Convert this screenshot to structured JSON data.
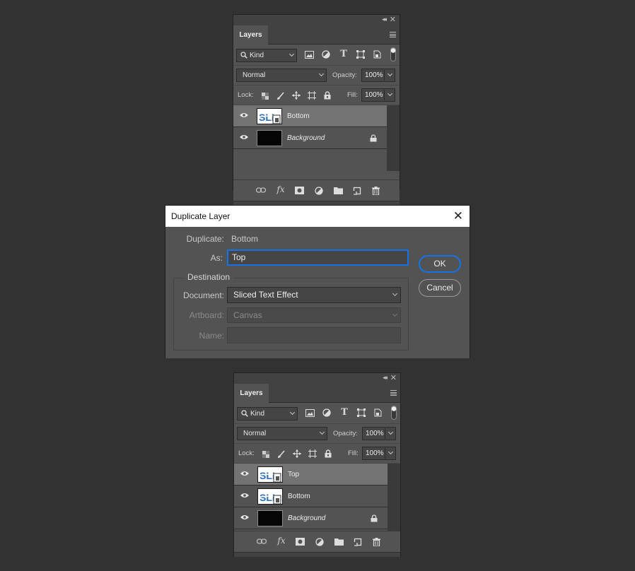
{
  "panel_top": {
    "tab": "Layers",
    "filter_kind": "Kind",
    "blend_mode": "Normal",
    "opacity_label": "Opacity:",
    "opacity": "100%",
    "lock_label": "Lock:",
    "fill_label": "Fill:",
    "fill": "100%",
    "layers": [
      {
        "name": "Bottom",
        "selected": true,
        "thumb": "text-effect",
        "locked": false,
        "italic": false
      },
      {
        "name": "Background",
        "selected": false,
        "thumb": "black",
        "locked": true,
        "italic": true
      }
    ]
  },
  "dialog": {
    "title": "Duplicate Layer",
    "duplicate_label": "Duplicate:",
    "duplicate_value": "Bottom",
    "as_label": "As:",
    "as_value": "Top",
    "destination_legend": "Destination",
    "document_label": "Document:",
    "document_value": "Sliced Text Effect",
    "artboard_label": "Artboard:",
    "artboard_value": "Canvas",
    "name_label": "Name:",
    "name_value": "",
    "ok_label": "OK",
    "cancel_label": "Cancel",
    "close_glyph": "✕"
  },
  "panel_bottom": {
    "tab": "Layers",
    "filter_kind": "Kind",
    "blend_mode": "Normal",
    "opacity_label": "Opacity:",
    "opacity": "100%",
    "lock_label": "Lock:",
    "fill_label": "Fill:",
    "fill": "100%",
    "layers": [
      {
        "name": "Top",
        "selected": true,
        "thumb": "text-effect",
        "locked": false,
        "italic": false
      },
      {
        "name": "Bottom",
        "selected": false,
        "thumb": "text-effect",
        "locked": false,
        "italic": false
      },
      {
        "name": "Background",
        "selected": false,
        "thumb": "black",
        "locked": true,
        "italic": true
      }
    ]
  },
  "colors": {
    "app_bg": "#323232",
    "panel_bg": "#535353",
    "selected_layer": "#737373",
    "accent_focus": "#1473e6"
  },
  "icons": {
    "filter": [
      "search-icon",
      "image-filter-icon",
      "adjustment-filter-icon",
      "type-filter-icon",
      "shape-filter-icon",
      "smart-object-filter-icon",
      "filter-toggle-icon"
    ],
    "lock": [
      "lock-transparent-icon",
      "lock-brush-icon",
      "lock-move-icon",
      "lock-artboard-icon",
      "lock-all-icon"
    ],
    "bottom_bar": [
      "link-icon",
      "fx-icon",
      "mask-icon",
      "adjustment-layer-icon",
      "group-folder-icon",
      "new-layer-icon",
      "trash-icon"
    ]
  }
}
